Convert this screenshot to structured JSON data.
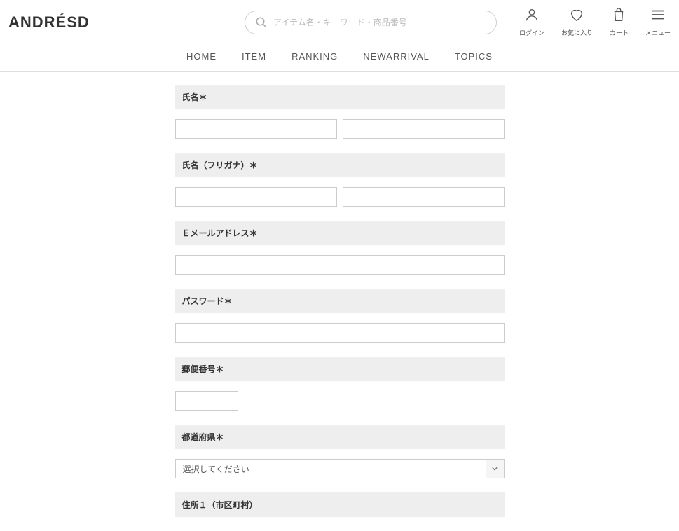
{
  "header": {
    "logo": "ANDRÉSD",
    "search_placeholder": "アイテム名・キーワード・商品番号",
    "utils": {
      "login": "ログイン",
      "favorite": "お気に入り",
      "cart": "カート",
      "menu": "メニュー"
    }
  },
  "nav": {
    "home": "HOME",
    "item": "ITEM",
    "ranking": "RANKING",
    "newarrival": "NEWARRIVAL",
    "topics": "TOPICS"
  },
  "form": {
    "name_label": "氏名＊",
    "kana_label": "氏名（フリガナ）＊",
    "email_label": "Ｅメールアドレス＊",
    "password_label": "パスワード＊",
    "zip_label": "郵便番号＊",
    "pref_label": "都道府県＊",
    "pref_placeholder": "選択してください",
    "addr1_label": "住所１（市区町村）"
  }
}
